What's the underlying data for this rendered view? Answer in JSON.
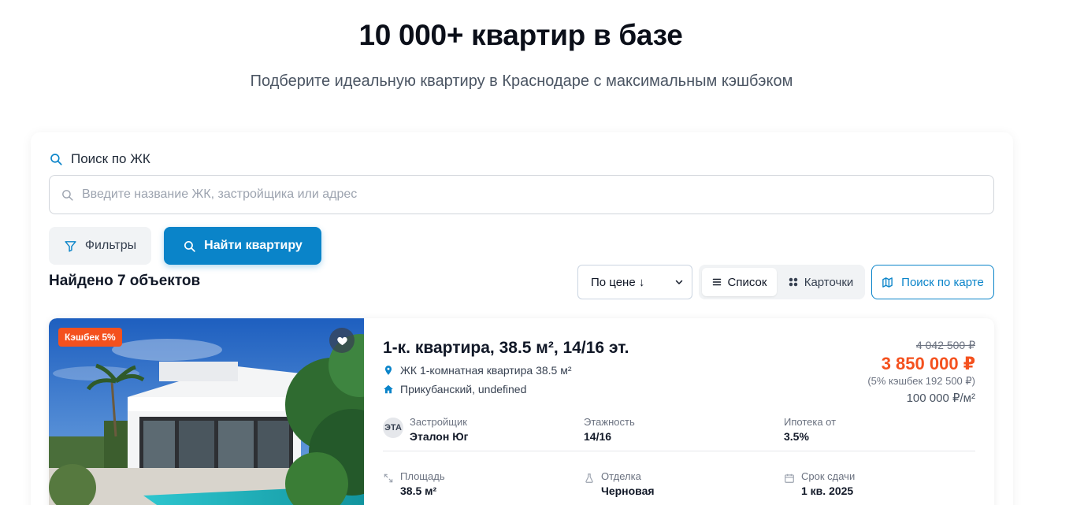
{
  "hero": {
    "title": "10 000+ квартир в базе",
    "subtitle": "Подберите идеальную квартиру в Краснодаре с максимальным кэшбэком"
  },
  "search": {
    "label": "Поиск по ЖК",
    "placeholder": "Введите название ЖК, застройщика или адрес",
    "value": ""
  },
  "actions": {
    "filters_label": "Фильтры",
    "find_label": "Найти квартиру"
  },
  "results": {
    "found_text": "Найдено 7 объектов",
    "sort_value": "По цене ↓",
    "view_list_label": "Список",
    "view_cards_label": "Карточки",
    "active_view": "list",
    "map_label": "Поиск по карте"
  },
  "listing": {
    "badge": "Кэшбек 5%",
    "title": "1-к. квартира, 38.5 м², 14/16 эт.",
    "complex": "ЖК 1-комнатная квартира 38.5 м²",
    "district": "Прикубанский, undefined",
    "price_old": "4 042 500 ₽",
    "price": "3 850 000 ₽",
    "cashback": "(5% кэшбек 192 500 ₽)",
    "price_per_m": "100 000 ₽/м²",
    "developer_logo": "ЭТА",
    "details": {
      "developer_label": "Застройщик",
      "developer_value": "Эталон Юг",
      "floor_label": "Этажность",
      "floor_value": "14/16",
      "mortgage_label": "Ипотека от",
      "mortgage_value": "3.5%",
      "area_label": "Площадь",
      "area_value": "38.5 м²",
      "finish_label": "Отделка",
      "finish_value": "Черновая",
      "deadline_label": "Срок сдачи",
      "deadline_value": "1 кв. 2025"
    }
  },
  "colors": {
    "accent": "#0a84c9",
    "price": "#f4511e",
    "badge": "#f4511e"
  },
  "icons": [
    "search-icon",
    "filter-icon",
    "list-icon",
    "grid-icon",
    "map-icon",
    "heart-icon",
    "location-pin-icon",
    "home-icon",
    "area-icon",
    "finish-icon",
    "calendar-icon",
    "chevron-down-icon"
  ]
}
